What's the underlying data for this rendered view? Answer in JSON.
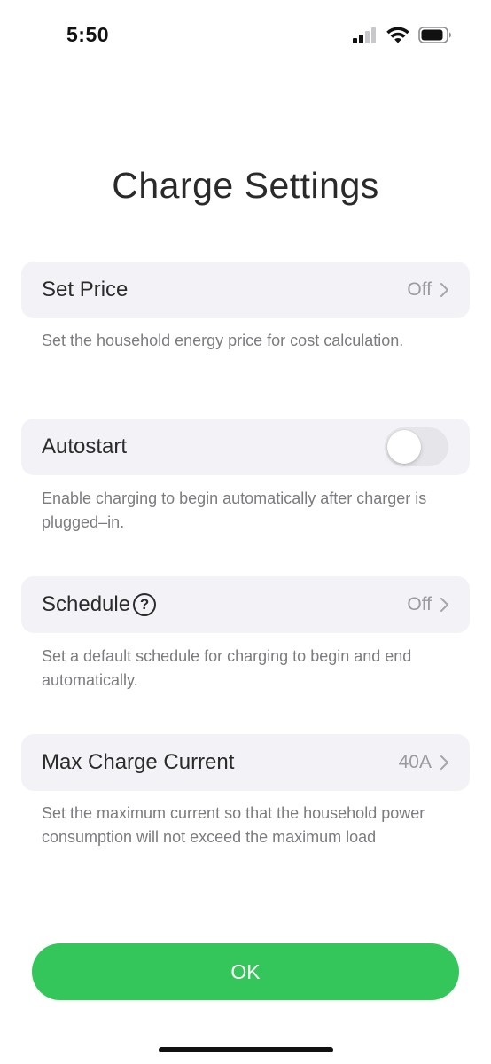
{
  "status_bar": {
    "time": "5:50",
    "icons": [
      "cellular-signal-icon",
      "wifi-icon",
      "battery-icon"
    ]
  },
  "title": "Charge Settings",
  "settings": [
    {
      "label": "Set Price",
      "value": "Off",
      "control": "chevron",
      "description": "Set the household energy price for cost calculation."
    },
    {
      "label": "Autostart",
      "control": "toggle",
      "toggle_on": false,
      "description": "Enable charging to begin automatically after charger is plugged–in."
    },
    {
      "label": "Schedule",
      "help_icon": "?",
      "value": "Off",
      "control": "chevron",
      "description": "Set a default schedule for charging to begin and end automatically."
    },
    {
      "label": "Max Charge Current",
      "value": "40A",
      "control": "chevron",
      "description": "Set the maximum current so that the household power consumption will not exceed the maximum load"
    }
  ],
  "ok_button": {
    "label": "OK"
  },
  "colors": {
    "accent": "#34c65a",
    "row_background": "#f3f3f7",
    "secondary_text": "#7c7c80",
    "value_text": "#9a9a9f"
  }
}
